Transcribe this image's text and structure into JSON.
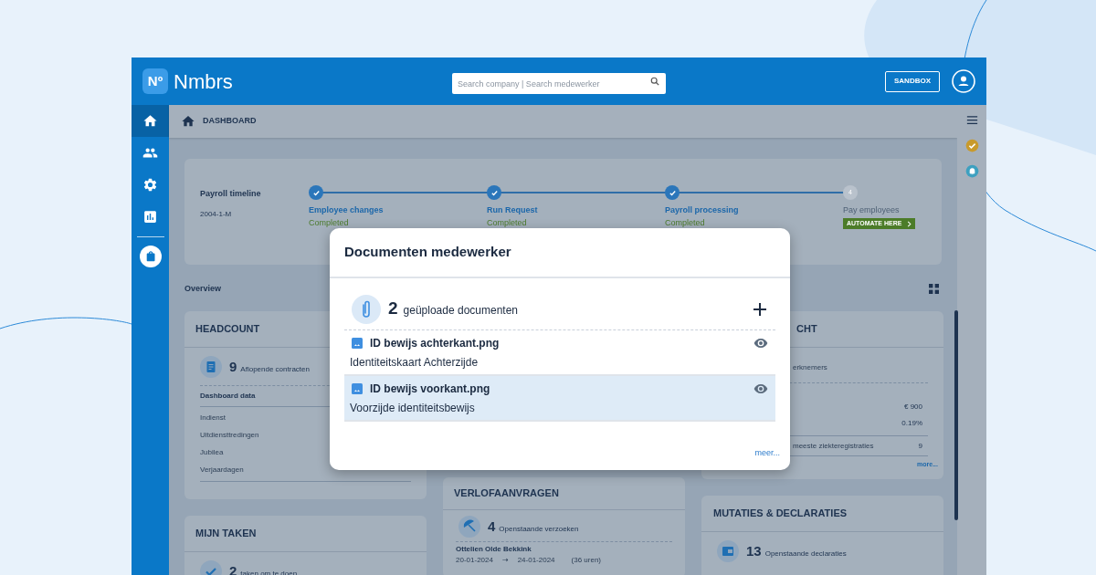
{
  "header": {
    "logo_mark": "Nº",
    "brand": "Nmbrs",
    "search": {
      "placeholder": "Search company | Search medewerker"
    },
    "environment_button": "SANDBOX"
  },
  "sidebar": {
    "items": [
      {
        "kind": "home",
        "selected": true
      },
      {
        "kind": "people",
        "selected": false
      },
      {
        "kind": "settings",
        "selected": false
      },
      {
        "kind": "chart",
        "selected": false
      },
      {
        "kind": "bag",
        "selected": false
      }
    ]
  },
  "breadcrumb": "DASHBOARD",
  "payroll_timeline": {
    "title": "Payroll timeline",
    "period": "2004-1-M",
    "steps": [
      {
        "label": "Employee changes",
        "status": "Completed",
        "done": true
      },
      {
        "label": "Run Request",
        "status": "Completed",
        "done": true
      },
      {
        "label": "Payroll processing",
        "status": "Completed",
        "done": true
      },
      {
        "label": "Pay employees",
        "number": "4",
        "done": false,
        "action": "AUTOMATE HERE"
      }
    ]
  },
  "overview": {
    "title": "Overview"
  },
  "headcount": {
    "title": "HEADCOUNT",
    "count": "9",
    "count_label": "Aflopende contracten",
    "table_heading": "Dashboard data",
    "rows": [
      "Indienst",
      "Uitdiensttredingen",
      "Jubilea",
      "Verjaardagen"
    ]
  },
  "my_tasks": {
    "title": "MIJN TAKEN",
    "count": "2",
    "count_label": "taken om te doen"
  },
  "leave_requests": {
    "title": "VERLOFAANVRAGEN",
    "count": "4",
    "count_label": "Openstaande verzoeken",
    "requests": [
      {
        "name": "Ottelien Olde Bekkink",
        "from": "20-01-2024",
        "arrow": "→",
        "to": "24-01-2024",
        "hours": "(36 uren)"
      }
    ]
  },
  "right_card": {
    "title": "CHT",
    "line": "erknemers",
    "rows": [
      {
        "value": "€ 900"
      },
      {
        "value": "0.19%"
      },
      {
        "label": "meeste ziekteregistraties",
        "value": "9"
      }
    ],
    "more": "more..."
  },
  "mutations": {
    "title": "MUTATIES & DECLARATIES",
    "count": "13",
    "count_label": "Openstaande declaraties"
  },
  "right_rail": {
    "items": [
      {
        "kind": "menu"
      },
      {
        "kind": "check"
      },
      {
        "kind": "bell"
      }
    ]
  },
  "modal": {
    "title": "Documenten medewerker",
    "count": "2",
    "count_label": "geüploade documenten",
    "documents": [
      {
        "name": "ID bewijs achterkant.png",
        "description": "Identiteitskaart Achterzijde",
        "selected": false
      },
      {
        "name": "ID bewijs voorkant.png",
        "description": "Voorzijde identiteitsbewijs",
        "selected": true
      }
    ],
    "more": "meer..."
  }
}
